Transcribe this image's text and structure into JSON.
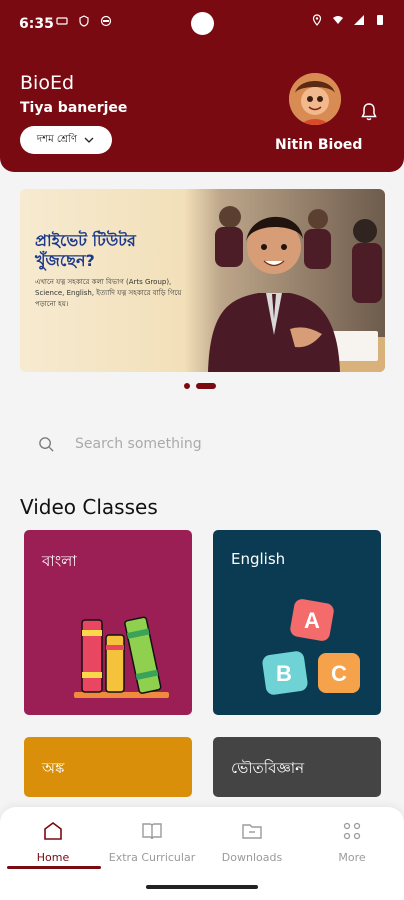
{
  "status": {
    "time": "6:35"
  },
  "header": {
    "brand": "BioEd",
    "teacher_name": "Tiya banerjee",
    "class_select": "দশম শ্রেণি",
    "username": "Nitin Bioed"
  },
  "banner": {
    "title": "প্রাইভেট টিউটর খুঁজছেন?",
    "description": "এখানে যত্ন সহকারে কলা বিভাগ (Arts Group), Science, English, ইত্যাদি যত্ন সহকারে বাড়ি গিয়ে পড়ানো হয়।"
  },
  "search": {
    "placeholder": "Search something"
  },
  "section": {
    "title": "Video Classes"
  },
  "cards": [
    {
      "label": "বাংলা",
      "color": "#9b1f55"
    },
    {
      "label": "English",
      "color": "#0b3b52"
    },
    {
      "label": "অঙ্ক",
      "color": "#d98f09"
    },
    {
      "label": "ভৌতবিজ্ঞান",
      "color": "#444444"
    }
  ],
  "bottom_nav": [
    {
      "label": "Home",
      "icon": "home-icon",
      "active": true
    },
    {
      "label": "Extra Curricular",
      "icon": "book-open-icon",
      "active": false
    },
    {
      "label": "Downloads",
      "icon": "folder-download-icon",
      "active": false
    },
    {
      "label": "More",
      "icon": "grid-dots-icon",
      "active": false
    }
  ],
  "colors": {
    "primary": "#7a0a12",
    "background": "#f4f4f4"
  }
}
